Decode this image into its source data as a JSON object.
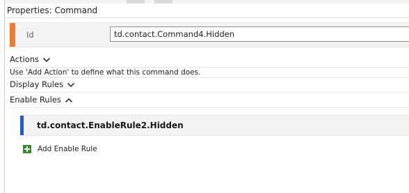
{
  "panel": {
    "title": "Properties: Command"
  },
  "id_field": {
    "label": "Id",
    "value": "td.contact.Command4.Hidden"
  },
  "actions": {
    "label": "Actions",
    "state": "collapsed",
    "hint": "Use 'Add Action' to define what this command does."
  },
  "display_rules": {
    "label": "Display Rules",
    "state": "collapsed"
  },
  "enable_rules": {
    "label": "Enable Rules",
    "state": "expanded",
    "items": [
      {
        "label": "td.contact.EnableRule2.Hidden"
      }
    ],
    "add_label": "Add Enable Rule"
  },
  "colors": {
    "id_accent": "#f07c32",
    "rule_accent": "#1f5bd0",
    "add_icon": "#3c8a2e"
  }
}
